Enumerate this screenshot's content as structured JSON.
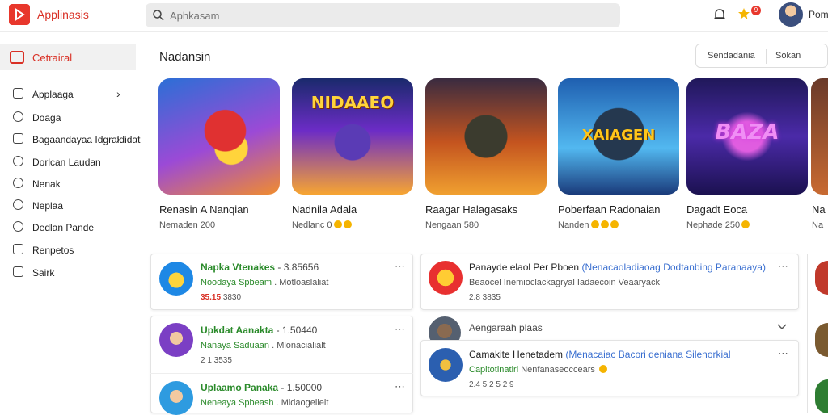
{
  "app": {
    "title": "Applinasis"
  },
  "search": {
    "placeholder": "Aphkasam"
  },
  "header": {
    "badge_count": "9",
    "user_name": "Pomni"
  },
  "sidebar": {
    "category": "Cetrairal",
    "items": [
      {
        "label": "Applaaga",
        "chevron": "›"
      },
      {
        "label": "Doaga",
        "chevron": ""
      },
      {
        "label": "Bagaandayaa Idgraldidat",
        "chevron": "›"
      },
      {
        "label": "Dorlcan Laudan",
        "chevron": ""
      },
      {
        "label": "Nenak",
        "chevron": ""
      },
      {
        "label": "Neplaa",
        "chevron": ""
      },
      {
        "label": "Dedlan Pande",
        "chevron": ""
      },
      {
        "label": "Renpetos",
        "chevron": ""
      },
      {
        "label": "Sairk",
        "chevron": ""
      }
    ]
  },
  "section": {
    "title": "Nadansin"
  },
  "segments": {
    "option1": "Sendadania",
    "option2": "Sokan"
  },
  "featured": [
    {
      "name": "Renasin A Nanqian",
      "meta": "Nemaden 200",
      "art_text": ""
    },
    {
      "name": "Nadnila Adala",
      "meta": "Nedlanc 0",
      "art_text": "NIDAAEO"
    },
    {
      "name": "Raagar Halagasaks",
      "meta": "Nengaan 580",
      "art_text": ""
    },
    {
      "name": "Poberfaan Radonaian",
      "meta": "Nanden",
      "art_text": "XAIAGEN"
    },
    {
      "name": "Dagadt Eoca",
      "meta": "Nephade 250",
      "art_text": "BAZA"
    },
    {
      "name": "Na",
      "meta": "Na",
      "art_text": ""
    }
  ],
  "list_left": [
    {
      "title": "Napka Vtenakes",
      "extra": "- 3.85656",
      "sub_green": "Noodaya Spbeam",
      "sub": ". Motloaslaliat",
      "stat_red": "35.15",
      "stat": "3830"
    },
    {
      "title": "Upkdat Aanakta",
      "extra": "- 1.50440",
      "sub_green": "Nanaya Saduaan",
      "sub": ". Mlonacialialt",
      "stat_red": "",
      "stat": "2 1 3535"
    },
    {
      "title": "Uplaamo Panaka",
      "extra": "- 1.50000",
      "sub_green": "Neneaya Spbeash",
      "sub": ". Midaogellelt",
      "stat_red": "",
      "stat": ""
    }
  ],
  "list_right": [
    {
      "title": "Panayde elaol Per Pboen",
      "blue": "(Nenacaoladiaoag Dodtanbing Paranaaya)",
      "sub": "Beaocel Inemioclackagryal Iadaecoin Veaaryack",
      "stat": "2.8 3835"
    },
    {
      "title": "Aengaraah plaas",
      "blue": "",
      "sub": "",
      "stat": ""
    },
    {
      "title": "Camakite Henetadem",
      "blue": "(Menacaiac Bacori deniana Silenorkial",
      "sub_green": "Capitotinatiri",
      "sub": "Nenfanaseoccears",
      "stat": "2.4 5 2 5 2 9"
    }
  ],
  "colors": {
    "brand": "#e8372c",
    "green": "#2a8a2a",
    "blue": "#3a6fd0"
  },
  "icons": [
    "logo-icon",
    "search-icon",
    "bell-icon",
    "star-icon",
    "chevron-down-icon",
    "more-icon"
  ]
}
